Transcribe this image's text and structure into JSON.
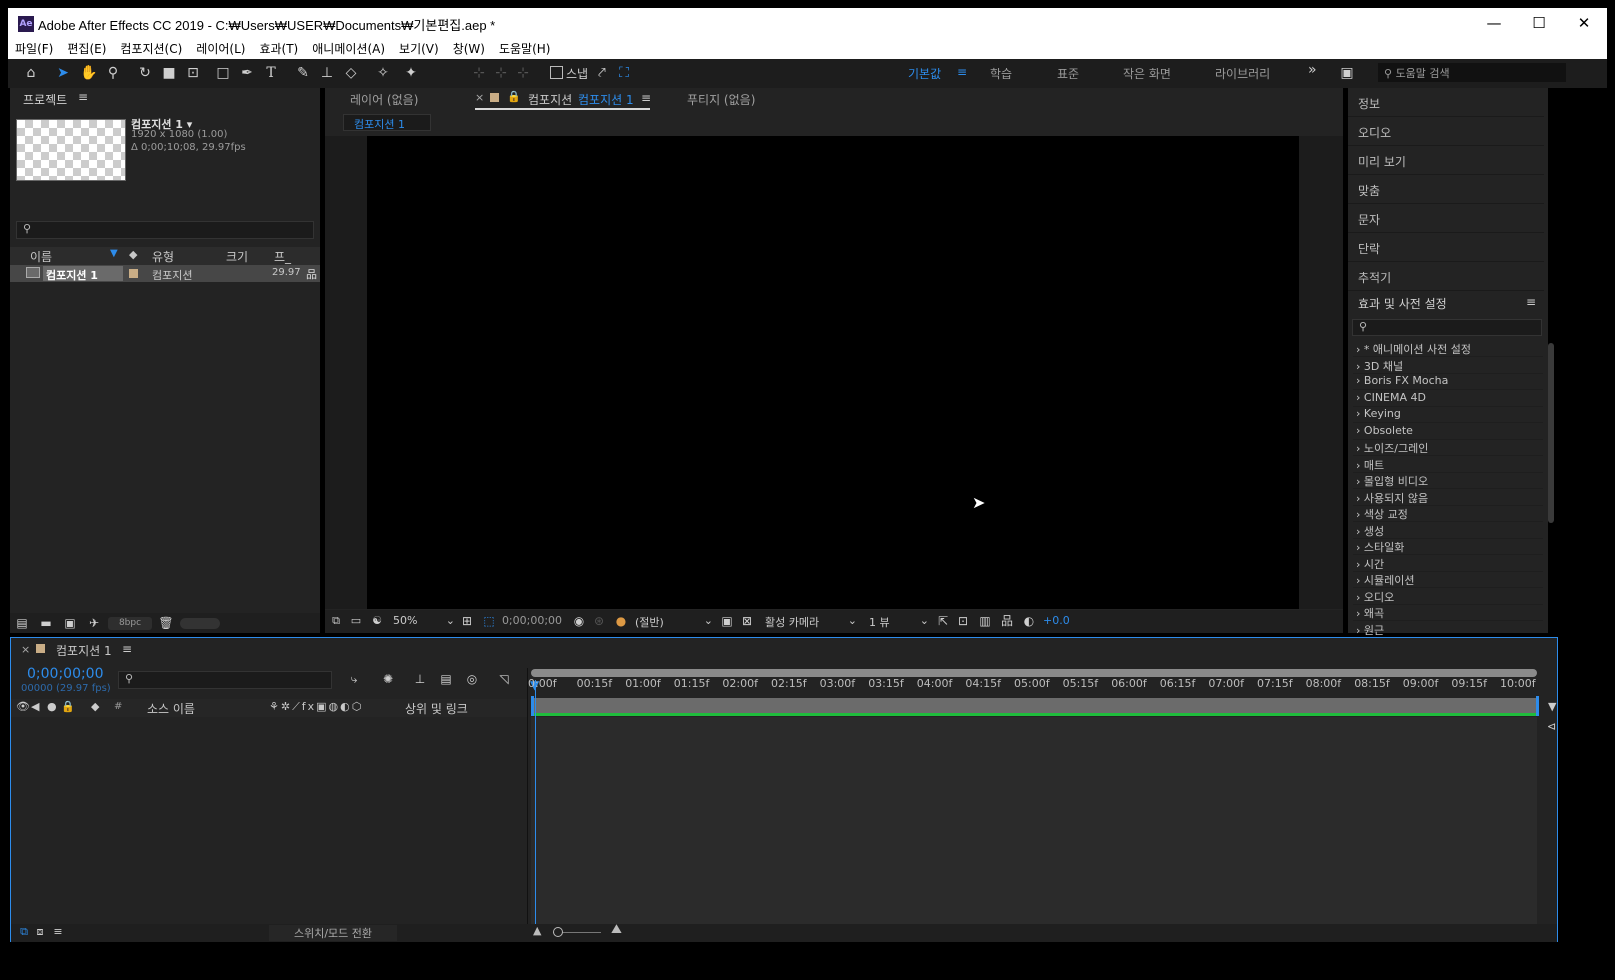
{
  "window": {
    "app_icon": "Ae",
    "title": "Adobe After Effects CC 2019 - C:₩Users₩USER₩Documents₩기본편집.aep *",
    "minimize": "—",
    "maximize": "☐",
    "close": "✕"
  },
  "menu": [
    "파일(F)",
    "편집(E)",
    "컴포지션(C)",
    "레이어(L)",
    "효과(T)",
    "애니메이션(A)",
    "보기(V)",
    "창(W)",
    "도움말(H)"
  ],
  "toolbar": {
    "snap_label": "스냅",
    "workspaces": [
      "기본값",
      "학습",
      "표준",
      "작은 화면",
      "라이브러리"
    ],
    "overflow": "»",
    "search_placeholder": "도움말 검색"
  },
  "project": {
    "title": "프로젝트",
    "item_name": "컴포지션 1 ▾",
    "item_size": "1920 x 1080 (1.00)",
    "item_duration": "Δ 0;00;10;08, 29.97fps",
    "columns": [
      "이름",
      "유형",
      "크기",
      "프_"
    ],
    "rows": [
      {
        "name": "컴포지션 1",
        "type": "컴포지션",
        "fps": "29.97"
      }
    ],
    "bpc": "8bpc"
  },
  "comp": {
    "tabs": {
      "layer": "레이어 (없음)",
      "comp_prefix": "컴포지션",
      "comp_name": "컴포지션 1",
      "footage": "푸티지 (없음)"
    },
    "breadcrumb": "컴포지션 1",
    "zoom": "50%",
    "timecode": "0;00;00;00",
    "resolution": "(절반)",
    "camera": "활성 카메라",
    "views": "1 뷰",
    "exposure": "+0.0"
  },
  "right_panels": [
    "정보",
    "오디오",
    "미리 보기",
    "맞춤",
    "문자",
    "단락",
    "추적기"
  ],
  "effects": {
    "title": "효과 및 사전 설정",
    "items": [
      "* 애니메이션 사전 설정",
      "3D 채널",
      "Boris FX Mocha",
      "CINEMA 4D",
      "Keying",
      "Obsolete",
      "노이즈/그레인",
      "매트",
      "몰입형 비디오",
      "사용되지 않음",
      "색상 교정",
      "생성",
      "스타일화",
      "시간",
      "시뮬레이션",
      "오디오",
      "왜곡",
      "원근"
    ]
  },
  "timeline": {
    "tab": "컴포지션 1",
    "timecode": "0;00;00;00",
    "frames": "00000 (29.97 fps)",
    "col_source": "소스 이름",
    "col_parent": "상위 및 링크",
    "col_num": "#",
    "switch_mode": "스위치/모드 전환",
    "ticks": [
      "0:00f",
      "00:15f",
      "01:00f",
      "01:15f",
      "02:00f",
      "02:15f",
      "03:00f",
      "03:15f",
      "04:00f",
      "04:15f",
      "05:00f",
      "05:15f",
      "06:00f",
      "06:15f",
      "07:00f",
      "07:15f",
      "08:00f",
      "08:15f",
      "09:00f",
      "09:15f",
      "10:00f"
    ]
  }
}
